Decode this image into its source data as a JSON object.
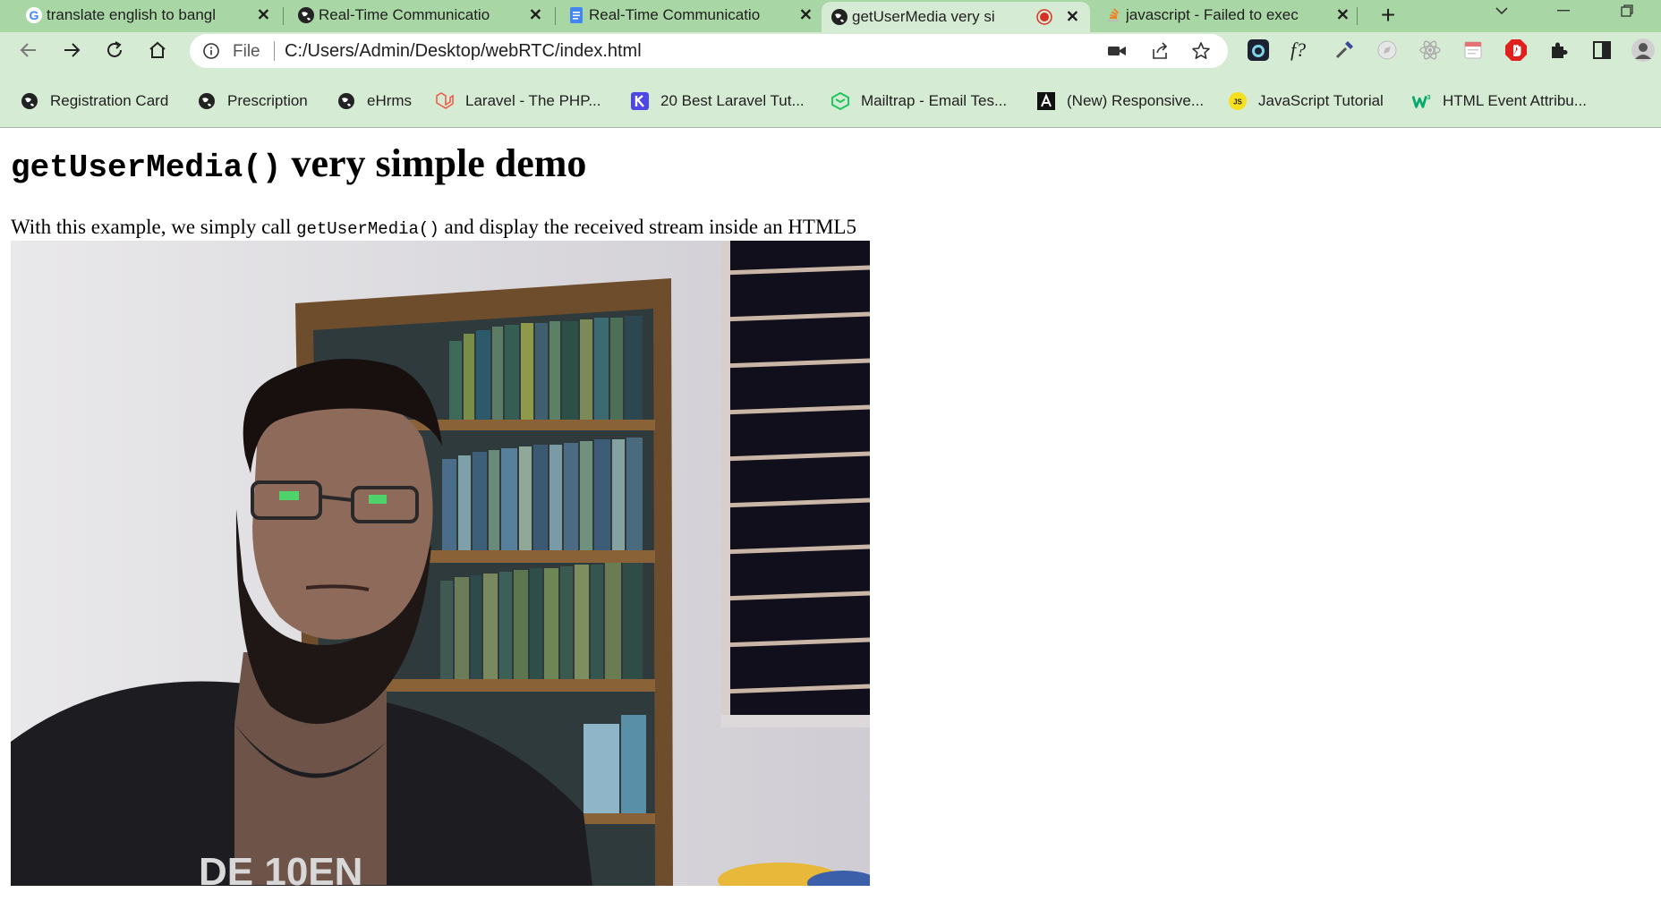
{
  "tabs": [
    {
      "title": "translate english to bangl",
      "icon": "google-icon",
      "close": "✕"
    },
    {
      "title": "Real-Time Communicatio",
      "icon": "globe-icon",
      "close": "✕"
    },
    {
      "title": "Real-Time Communicatio",
      "icon": "docs-icon",
      "close": "✕"
    },
    {
      "title": "getUserMedia very si",
      "icon": "globe-icon",
      "close": "✕",
      "active": true,
      "recording": true
    },
    {
      "title": "javascript - Failed to exec",
      "icon": "stackoverflow-icon",
      "close": "✕"
    }
  ],
  "new_tab_label": "+",
  "toolbar": {
    "file_label": "File",
    "url": "C:/Users/Admin/Desktop/webRTC/index.html"
  },
  "bookmarks": [
    {
      "label": "Registration Card",
      "icon": "globe-icon"
    },
    {
      "label": "Prescription",
      "icon": "globe-icon"
    },
    {
      "label": "eHrms",
      "icon": "globe-icon"
    },
    {
      "label": "Laravel - The PHP...",
      "icon": "laravel-icon"
    },
    {
      "label": "20 Best Laravel Tut...",
      "icon": "k-icon"
    },
    {
      "label": "Mailtrap - Email Tes...",
      "icon": "mailtrap-icon"
    },
    {
      "label": "(New) Responsive...",
      "icon": "a-icon"
    },
    {
      "label": "JavaScript Tutorial",
      "icon": "js-icon"
    },
    {
      "label": "HTML Event Attribu...",
      "icon": "w3-icon"
    }
  ],
  "page": {
    "title_code": "getUserMedia()",
    "title_rest": " very simple demo",
    "desc_before": "With this example, we simply call ",
    "desc_code": "getUserMedia()",
    "desc_after": " and display the received stream inside an HTML5"
  },
  "colors": {
    "tabstrip": "#a9d6a5",
    "toolbar": "#d6ebd3",
    "record": "#d93025"
  }
}
